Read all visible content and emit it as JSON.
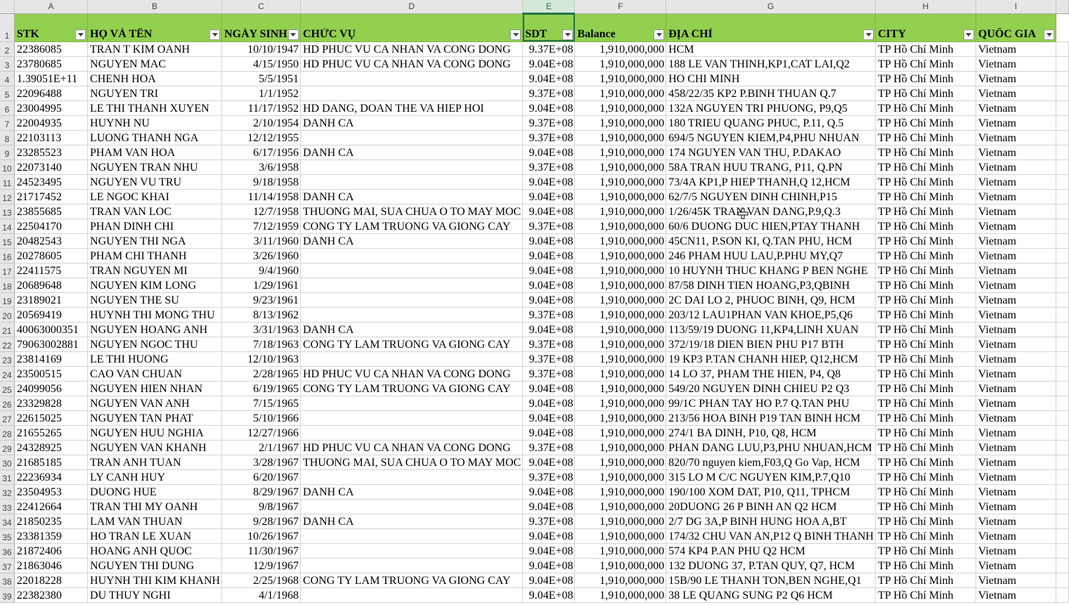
{
  "columns": [
    "A",
    "B",
    "C",
    "D",
    "E",
    "F",
    "G",
    "H",
    "I"
  ],
  "selected_column": "E",
  "headers": [
    "STK",
    "HỌ VÀ TÊN",
    "NGÀY SINH",
    "CHỨC VỤ",
    "SDT",
    "Balance",
    "ĐỊA CHỈ",
    "CITY",
    "QUỐC GIA"
  ],
  "rows": [
    {
      "n": "2",
      "stk": "22386085",
      "name": "TRAN T KIM OANH",
      "dob": "10/10/1947",
      "role": "HD PHUC VU CA NHAN VA CONG DONG",
      "sdt": "9.37E+08",
      "bal": "1,910,000,000",
      "addr": "HCM",
      "city": "TP Hồ Chí Minh",
      "country": "Vietnam"
    },
    {
      "n": "3",
      "stk": "23780685",
      "name": "NGUYEN MAC",
      "dob": "4/15/1950",
      "role": "HD PHUC VU CA NHAN VA CONG DONG",
      "sdt": "9.04E+08",
      "bal": "1,910,000,000",
      "addr": "188 LE VAN THINH,KP1,CAT LAI,Q2",
      "city": "TP Hồ Chí Minh",
      "country": "Vietnam"
    },
    {
      "n": "4",
      "stk": "1.39051E+11",
      "name": "CHENH HOA",
      "dob": "5/5/1951",
      "role": "",
      "sdt": "9.04E+08",
      "bal": "1,910,000,000",
      "addr": "HO CHI MINH",
      "city": "TP Hồ Chí Minh",
      "country": "Vietnam"
    },
    {
      "n": "5",
      "stk": "22096488",
      "name": "NGUYEN TRI",
      "dob": "1/1/1952",
      "role": "",
      "sdt": "9.37E+08",
      "bal": "1,910,000,000",
      "addr": "458/22/35 KP2 P.BINH THUAN Q.7",
      "city": "TP Hồ Chí Minh",
      "country": "Vietnam"
    },
    {
      "n": "6",
      "stk": "23004995",
      "name": "LE THI THANH XUYEN",
      "dob": "11/17/1952",
      "role": "HD DANG, DOAN THE VA HIEP HOI",
      "sdt": "9.04E+08",
      "bal": "1,910,000,000",
      "addr": "132A NGUYEN TRI PHUONG, P9,Q5",
      "city": "TP Hồ Chí Minh",
      "country": "Vietnam"
    },
    {
      "n": "7",
      "stk": "22004935",
      "name": "HUYNH NU",
      "dob": "2/10/1954",
      "role": "DANH CA",
      "sdt": "9.37E+08",
      "bal": "1,910,000,000",
      "addr": "180 TRIEU QUANG PHUC, P.11, Q.5",
      "city": "TP Hồ Chí Minh",
      "country": "Vietnam"
    },
    {
      "n": "8",
      "stk": "22103113",
      "name": "LUONG THANH NGA",
      "dob": "12/12/1955",
      "role": "",
      "sdt": "9.37E+08",
      "bal": "1,910,000,000",
      "addr": "694/5 NGUYEN KIEM,P4,PHU NHUAN",
      "city": "TP Hồ Chí Minh",
      "country": "Vietnam"
    },
    {
      "n": "9",
      "stk": "23285523",
      "name": "PHAM VAN HOA",
      "dob": "6/17/1956",
      "role": "DANH CA",
      "sdt": "9.04E+08",
      "bal": "1,910,000,000",
      "addr": "174 NGUYEN VAN THU, P.DAKAO",
      "city": "TP Hồ Chí Minh",
      "country": "Vietnam"
    },
    {
      "n": "10",
      "stk": "22073140",
      "name": "NGUYEN TRAN NHU",
      "dob": "3/6/1958",
      "role": "",
      "sdt": "9.37E+08",
      "bal": "1,910,000,000",
      "addr": "58A TRAN HUU TRANG, P11, Q.PN",
      "city": "TP Hồ Chí Minh",
      "country": "Vietnam"
    },
    {
      "n": "11",
      "stk": "24523495",
      "name": "NGUYEN VU TRU",
      "dob": "9/18/1958",
      "role": "",
      "sdt": "9.04E+08",
      "bal": "1,910,000,000",
      "addr": "73/4A KP1,P HIEP THANH,Q 12,HCM",
      "city": "TP Hồ Chí Minh",
      "country": "Vietnam"
    },
    {
      "n": "12",
      "stk": "21717452",
      "name": "LE NGOC KHAI",
      "dob": "11/14/1958",
      "role": "DANH CA",
      "sdt": "9.04E+08",
      "bal": "1,910,000,000",
      "addr": "62/7/5 NGUYEN DINH CHINH,P15",
      "city": "TP Hồ Chí Minh",
      "country": "Vietnam"
    },
    {
      "n": "13",
      "stk": "23855685",
      "name": "TRAN VAN LOC",
      "dob": "12/7/1958",
      "role": "THUONG MAI, SUA CHUA O TO MAY MOC",
      "sdt": "9.04E+08",
      "bal": "1,910,000,000",
      "addr": "1/26/45K TRAN VAN DANG,P.9,Q.3",
      "city": "TP Hồ Chí Minh",
      "country": "Vietnam"
    },
    {
      "n": "14",
      "stk": "22504170",
      "name": "PHAN DINH CHI",
      "dob": "7/12/1959",
      "role": "CONG TY LAM TRUONG VA GIONG CAY",
      "sdt": "9.37E+08",
      "bal": "1,910,000,000",
      "addr": "60/6 DUONG DUC HIEN,PTAY THANH",
      "city": "TP Hồ Chí Minh",
      "country": "Vietnam"
    },
    {
      "n": "15",
      "stk": "20482543",
      "name": "NGUYEN THI NGA",
      "dob": "3/11/1960",
      "role": "DANH CA",
      "sdt": "9.04E+08",
      "bal": "1,910,000,000",
      "addr": "45CN11, P.SON KI, Q.TAN PHU, HCM",
      "city": "TP Hồ Chí Minh",
      "country": "Vietnam"
    },
    {
      "n": "16",
      "stk": "20278605",
      "name": "PHAM CHI THANH",
      "dob": "3/26/1960",
      "role": "",
      "sdt": "9.04E+08",
      "bal": "1,910,000,000",
      "addr": "246 PHAM HUU LAU,P.PHU MY,Q7",
      "city": "TP Hồ Chí Minh",
      "country": "Vietnam"
    },
    {
      "n": "17",
      "stk": "22411575",
      "name": "TRAN NGUYEN MI",
      "dob": "9/4/1960",
      "role": "",
      "sdt": "9.04E+08",
      "bal": "1,910,000,000",
      "addr": "10 HUYNH THUC KHANG P BEN NGHE",
      "city": "TP Hồ Chí Minh",
      "country": "Vietnam"
    },
    {
      "n": "18",
      "stk": "20689648",
      "name": "NGUYEN KIM LONG",
      "dob": "1/29/1961",
      "role": "",
      "sdt": "9.04E+08",
      "bal": "1,910,000,000",
      "addr": "87/58 DINH TIEN HOANG,P3,QBINH",
      "city": "TP Hồ Chí Minh",
      "country": "Vietnam"
    },
    {
      "n": "19",
      "stk": "23189021",
      "name": "NGUYEN THE SU",
      "dob": "9/23/1961",
      "role": "",
      "sdt": "9.04E+08",
      "bal": "1,910,000,000",
      "addr": "2C DAI LO 2, PHUOC BINH, Q9, HCM",
      "city": "TP Hồ Chí Minh",
      "country": "Vietnam"
    },
    {
      "n": "20",
      "stk": "20569419",
      "name": "HUYNH THI MONG THU",
      "dob": "8/13/1962",
      "role": "",
      "sdt": "9.37E+08",
      "bal": "1,910,000,000",
      "addr": "203/12 LAU1PHAN VAN KHOE,P5,Q6",
      "city": "TP Hồ Chí Minh",
      "country": "Vietnam"
    },
    {
      "n": "21",
      "stk": "40063000351",
      "name": "NGUYEN HOANG ANH",
      "dob": "3/31/1963",
      "role": "DANH CA",
      "sdt": "9.04E+08",
      "bal": "1,910,000,000",
      "addr": "113/59/19 DUONG 11,KP4,LINH XUAN",
      "city": "TP Hồ Chí Minh",
      "country": "Vietnam"
    },
    {
      "n": "22",
      "stk": "79063002881",
      "name": "NGUYEN NGOC THU",
      "dob": "7/18/1963",
      "role": "CONG TY LAM TRUONG VA GIONG CAY",
      "sdt": "9.37E+08",
      "bal": "1,910,000,000",
      "addr": "372/19/18 DIEN BIEN PHU P17 BTH",
      "city": "TP Hồ Chí Minh",
      "country": "Vietnam"
    },
    {
      "n": "23",
      "stk": "23814169",
      "name": "LE THI HUONG",
      "dob": "12/10/1963",
      "role": "",
      "sdt": "9.37E+08",
      "bal": "1,910,000,000",
      "addr": "19 KP3 P.TAN CHANH HIEP, Q12,HCM",
      "city": "TP Hồ Chí Minh",
      "country": "Vietnam"
    },
    {
      "n": "24",
      "stk": "23500515",
      "name": "CAO VAN CHUAN",
      "dob": "2/28/1965",
      "role": "HD PHUC VU CA NHAN VA CONG DONG",
      "sdt": "9.37E+08",
      "bal": "1,910,000,000",
      "addr": "14 LO 37, PHAM THE HIEN, P4, Q8",
      "city": "TP Hồ Chí Minh",
      "country": "Vietnam"
    },
    {
      "n": "25",
      "stk": "24099056",
      "name": "NGUYEN HIEN NHAN",
      "dob": "6/19/1965",
      "role": "CONG TY LAM TRUONG VA GIONG CAY",
      "sdt": "9.04E+08",
      "bal": "1,910,000,000",
      "addr": "549/20 NGUYEN DINH CHIEU P2 Q3",
      "city": "TP Hồ Chí Minh",
      "country": "Vietnam"
    },
    {
      "n": "26",
      "stk": "23329828",
      "name": "NGUYEN VAN ANH",
      "dob": "7/15/1965",
      "role": "",
      "sdt": "9.04E+08",
      "bal": "1,910,000,000",
      "addr": "99/1C PHAN TAY HO P.7 Q.TAN PHU",
      "city": "TP Hồ Chí Minh",
      "country": "Vietnam"
    },
    {
      "n": "27",
      "stk": "22615025",
      "name": "NGUYEN TAN PHAT",
      "dob": "5/10/1966",
      "role": "",
      "sdt": "9.04E+08",
      "bal": "1,910,000,000",
      "addr": "213/56 HOA BINH P19 TAN BINH HCM",
      "city": "TP Hồ Chí Minh",
      "country": "Vietnam"
    },
    {
      "n": "28",
      "stk": "21655265",
      "name": "NGUYEN HUU NGHIA",
      "dob": "12/27/1966",
      "role": "",
      "sdt": "9.04E+08",
      "bal": "1,910,000,000",
      "addr": "274/1 BA DINH, P10, Q8, HCM",
      "city": "TP Hồ Chí Minh",
      "country": "Vietnam"
    },
    {
      "n": "29",
      "stk": "24328925",
      "name": "NGUYEN VAN KHANH",
      "dob": "2/1/1967",
      "role": "HD PHUC VU CA NHAN VA CONG DONG",
      "sdt": "9.37E+08",
      "bal": "1,910,000,000",
      "addr": "PHAN DANG LUU,P3,PHU NHUAN,HCM",
      "city": "TP Hồ Chí Minh",
      "country": "Vietnam"
    },
    {
      "n": "30",
      "stk": "21685185",
      "name": "TRAN ANH  TUAN",
      "dob": "3/28/1967",
      "role": "THUONG MAI, SUA CHUA O TO MAY MOC",
      "sdt": "9.04E+08",
      "bal": "1,910,000,000",
      "addr": "820/70 nguyen kiem,F03,Q Go Vap, HCM",
      "city": "TP Hồ Chí Minh",
      "country": "Vietnam"
    },
    {
      "n": "31",
      "stk": "22236934",
      "name": "LY CANH HUY",
      "dob": "6/20/1967",
      "role": "",
      "sdt": "9.37E+08",
      "bal": "1,910,000,000",
      "addr": "315 LO M C/C NGUYEN KIM,P.7,Q10",
      "city": "TP Hồ Chí Minh",
      "country": "Vietnam"
    },
    {
      "n": "32",
      "stk": "23504953",
      "name": "DUONG HUE",
      "dob": "8/29/1967",
      "role": "DANH CA",
      "sdt": "9.04E+08",
      "bal": "1,910,000,000",
      "addr": "190/100 XOM DAT, P10, Q11, TPHCM",
      "city": "TP Hồ Chí Minh",
      "country": "Vietnam"
    },
    {
      "n": "33",
      "stk": "22412664",
      "name": "TRAN THI MY OANH",
      "dob": "9/8/1967",
      "role": "",
      "sdt": "9.04E+08",
      "bal": "1,910,000,000",
      "addr": "20DUONG 26  P BINH AN Q2 HCM",
      "city": "TP Hồ Chí Minh",
      "country": "Vietnam"
    },
    {
      "n": "34",
      "stk": "21850235",
      "name": "LAM VAN THUAN",
      "dob": "9/28/1967",
      "role": "DANH CA",
      "sdt": "9.37E+08",
      "bal": "1,910,000,000",
      "addr": "2/7 DG 3A,P BINH HUNG HOA A,BT",
      "city": "TP Hồ Chí Minh",
      "country": "Vietnam"
    },
    {
      "n": "35",
      "stk": "23381359",
      "name": "HO TRAN LE XUAN",
      "dob": "10/26/1967",
      "role": "",
      "sdt": "9.04E+08",
      "bal": "1,910,000,000",
      "addr": "174/32 CHU VAN AN,P12 Q BINH THANH",
      "city": "TP Hồ Chí Minh",
      "country": "Vietnam"
    },
    {
      "n": "36",
      "stk": "21872406",
      "name": "HOANG ANH QUOC",
      "dob": "11/30/1967",
      "role": "",
      "sdt": "9.04E+08",
      "bal": "1,910,000,000",
      "addr": "574 KP4 P.AN PHU Q2 HCM",
      "city": "TP Hồ Chí Minh",
      "country": "Vietnam"
    },
    {
      "n": "37",
      "stk": "21863046",
      "name": "NGUYEN THI DUNG",
      "dob": "12/9/1967",
      "role": "",
      "sdt": "9.04E+08",
      "bal": "1,910,000,000",
      "addr": "132 DUONG 37, P.TAN QUY, Q7, HCM",
      "city": "TP Hồ Chí Minh",
      "country": "Vietnam"
    },
    {
      "n": "38",
      "stk": "22018228",
      "name": "HUYNH THI KIM KHANH",
      "dob": "2/25/1968",
      "role": "CONG TY LAM TRUONG VA GIONG CAY",
      "sdt": "9.04E+08",
      "bal": "1,910,000,000",
      "addr": "15B/90 LE THANH TON,BEN NGHE,Q1",
      "city": "TP Hồ Chí Minh",
      "country": "Vietnam"
    },
    {
      "n": "39",
      "stk": "22382380",
      "name": "DU THUY NGHI",
      "dob": "4/1/1968",
      "role": "",
      "sdt": "9.04E+08",
      "bal": "1,910,000,000",
      "addr": "38 LE QUANG SUNG P2 Q6 HCM",
      "city": "TP Hồ Chí Minh",
      "country": "Vietnam"
    }
  ],
  "icons": {
    "filter": "filter-dropdown-icon",
    "cursor": "move-cursor-icon"
  },
  "colors": {
    "header_fill": "#92d050",
    "selected_column_accent": "#217346"
  }
}
